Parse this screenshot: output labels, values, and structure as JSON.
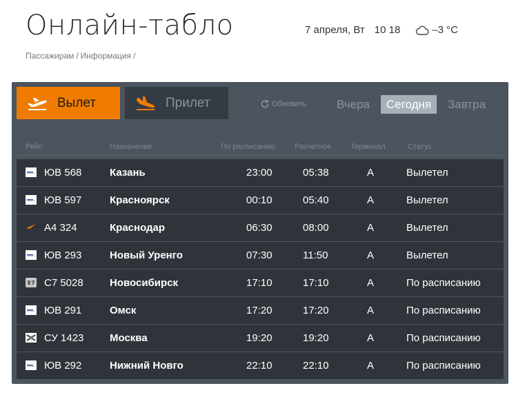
{
  "header": {
    "title": "Онлайн-табло",
    "date": "7 апреля, Вт",
    "time": "10  18",
    "weather_icon": "cloud-icon",
    "temperature": "–3 °C"
  },
  "breadcrumb": {
    "items": [
      "Пассажирам",
      "Информация"
    ],
    "separator": "/"
  },
  "tabs": {
    "depart_label": "Вылет",
    "arrive_label": "Прилет",
    "active": "depart"
  },
  "toolbar": {
    "refresh_label": "Обновить",
    "yesterday": "Вчера",
    "today": "Сегодня",
    "tomorrow": "Завтра",
    "active_day": "today"
  },
  "columns": {
    "flight": "Рейс",
    "destination": "Назначение",
    "scheduled": "По расписанию",
    "estimated": "Расчетное",
    "terminal": "Терминал",
    "status": "Статус"
  },
  "colors": {
    "accent": "#ef7c00",
    "board": "#4c545e",
    "row": "#2f343b"
  },
  "flights": [
    {
      "airline_icon": "utair-logo-icon",
      "flight": "ЮВ 568",
      "destination": "Казань",
      "scheduled": "23:00",
      "estimated": "05:38",
      "terminal": "A",
      "status": "Вылетел"
    },
    {
      "airline_icon": "utair-logo-icon",
      "flight": "ЮВ 597",
      "destination": "Красноярск",
      "scheduled": "00:10",
      "estimated": "05:40",
      "terminal": "A",
      "status": "Вылетел"
    },
    {
      "airline_icon": "aeroflot-logo-icon",
      "flight": "А4 324",
      "destination": "Краснодар",
      "scheduled": "06:30",
      "estimated": "08:00",
      "terminal": "A",
      "status": "Вылетел"
    },
    {
      "airline_icon": "utair-logo-icon",
      "flight": "ЮВ 293",
      "destination": "Новый Уренго",
      "scheduled": "07:30",
      "estimated": "11:50",
      "terminal": "A",
      "status": "Вылетел"
    },
    {
      "airline_icon": "s7-logo-icon",
      "flight": "С7 5028",
      "destination": "Новосибирск",
      "scheduled": "17:10",
      "estimated": "17:10",
      "terminal": "A",
      "status": "По расписанию"
    },
    {
      "airline_icon": "utair-logo-icon",
      "flight": "ЮВ 291",
      "destination": "Омск",
      "scheduled": "17:20",
      "estimated": "17:20",
      "terminal": "A",
      "status": "По расписанию"
    },
    {
      "airline_icon": "rusline-logo-icon",
      "flight": "СУ 1423",
      "destination": "Москва",
      "scheduled": "19:20",
      "estimated": "19:20",
      "terminal": "A",
      "status": "По расписанию"
    },
    {
      "airline_icon": "utair-logo-icon",
      "flight": "ЮВ 292",
      "destination": "Нижний Новго",
      "scheduled": "22:10",
      "estimated": "22:10",
      "terminal": "A",
      "status": "По расписанию"
    }
  ]
}
